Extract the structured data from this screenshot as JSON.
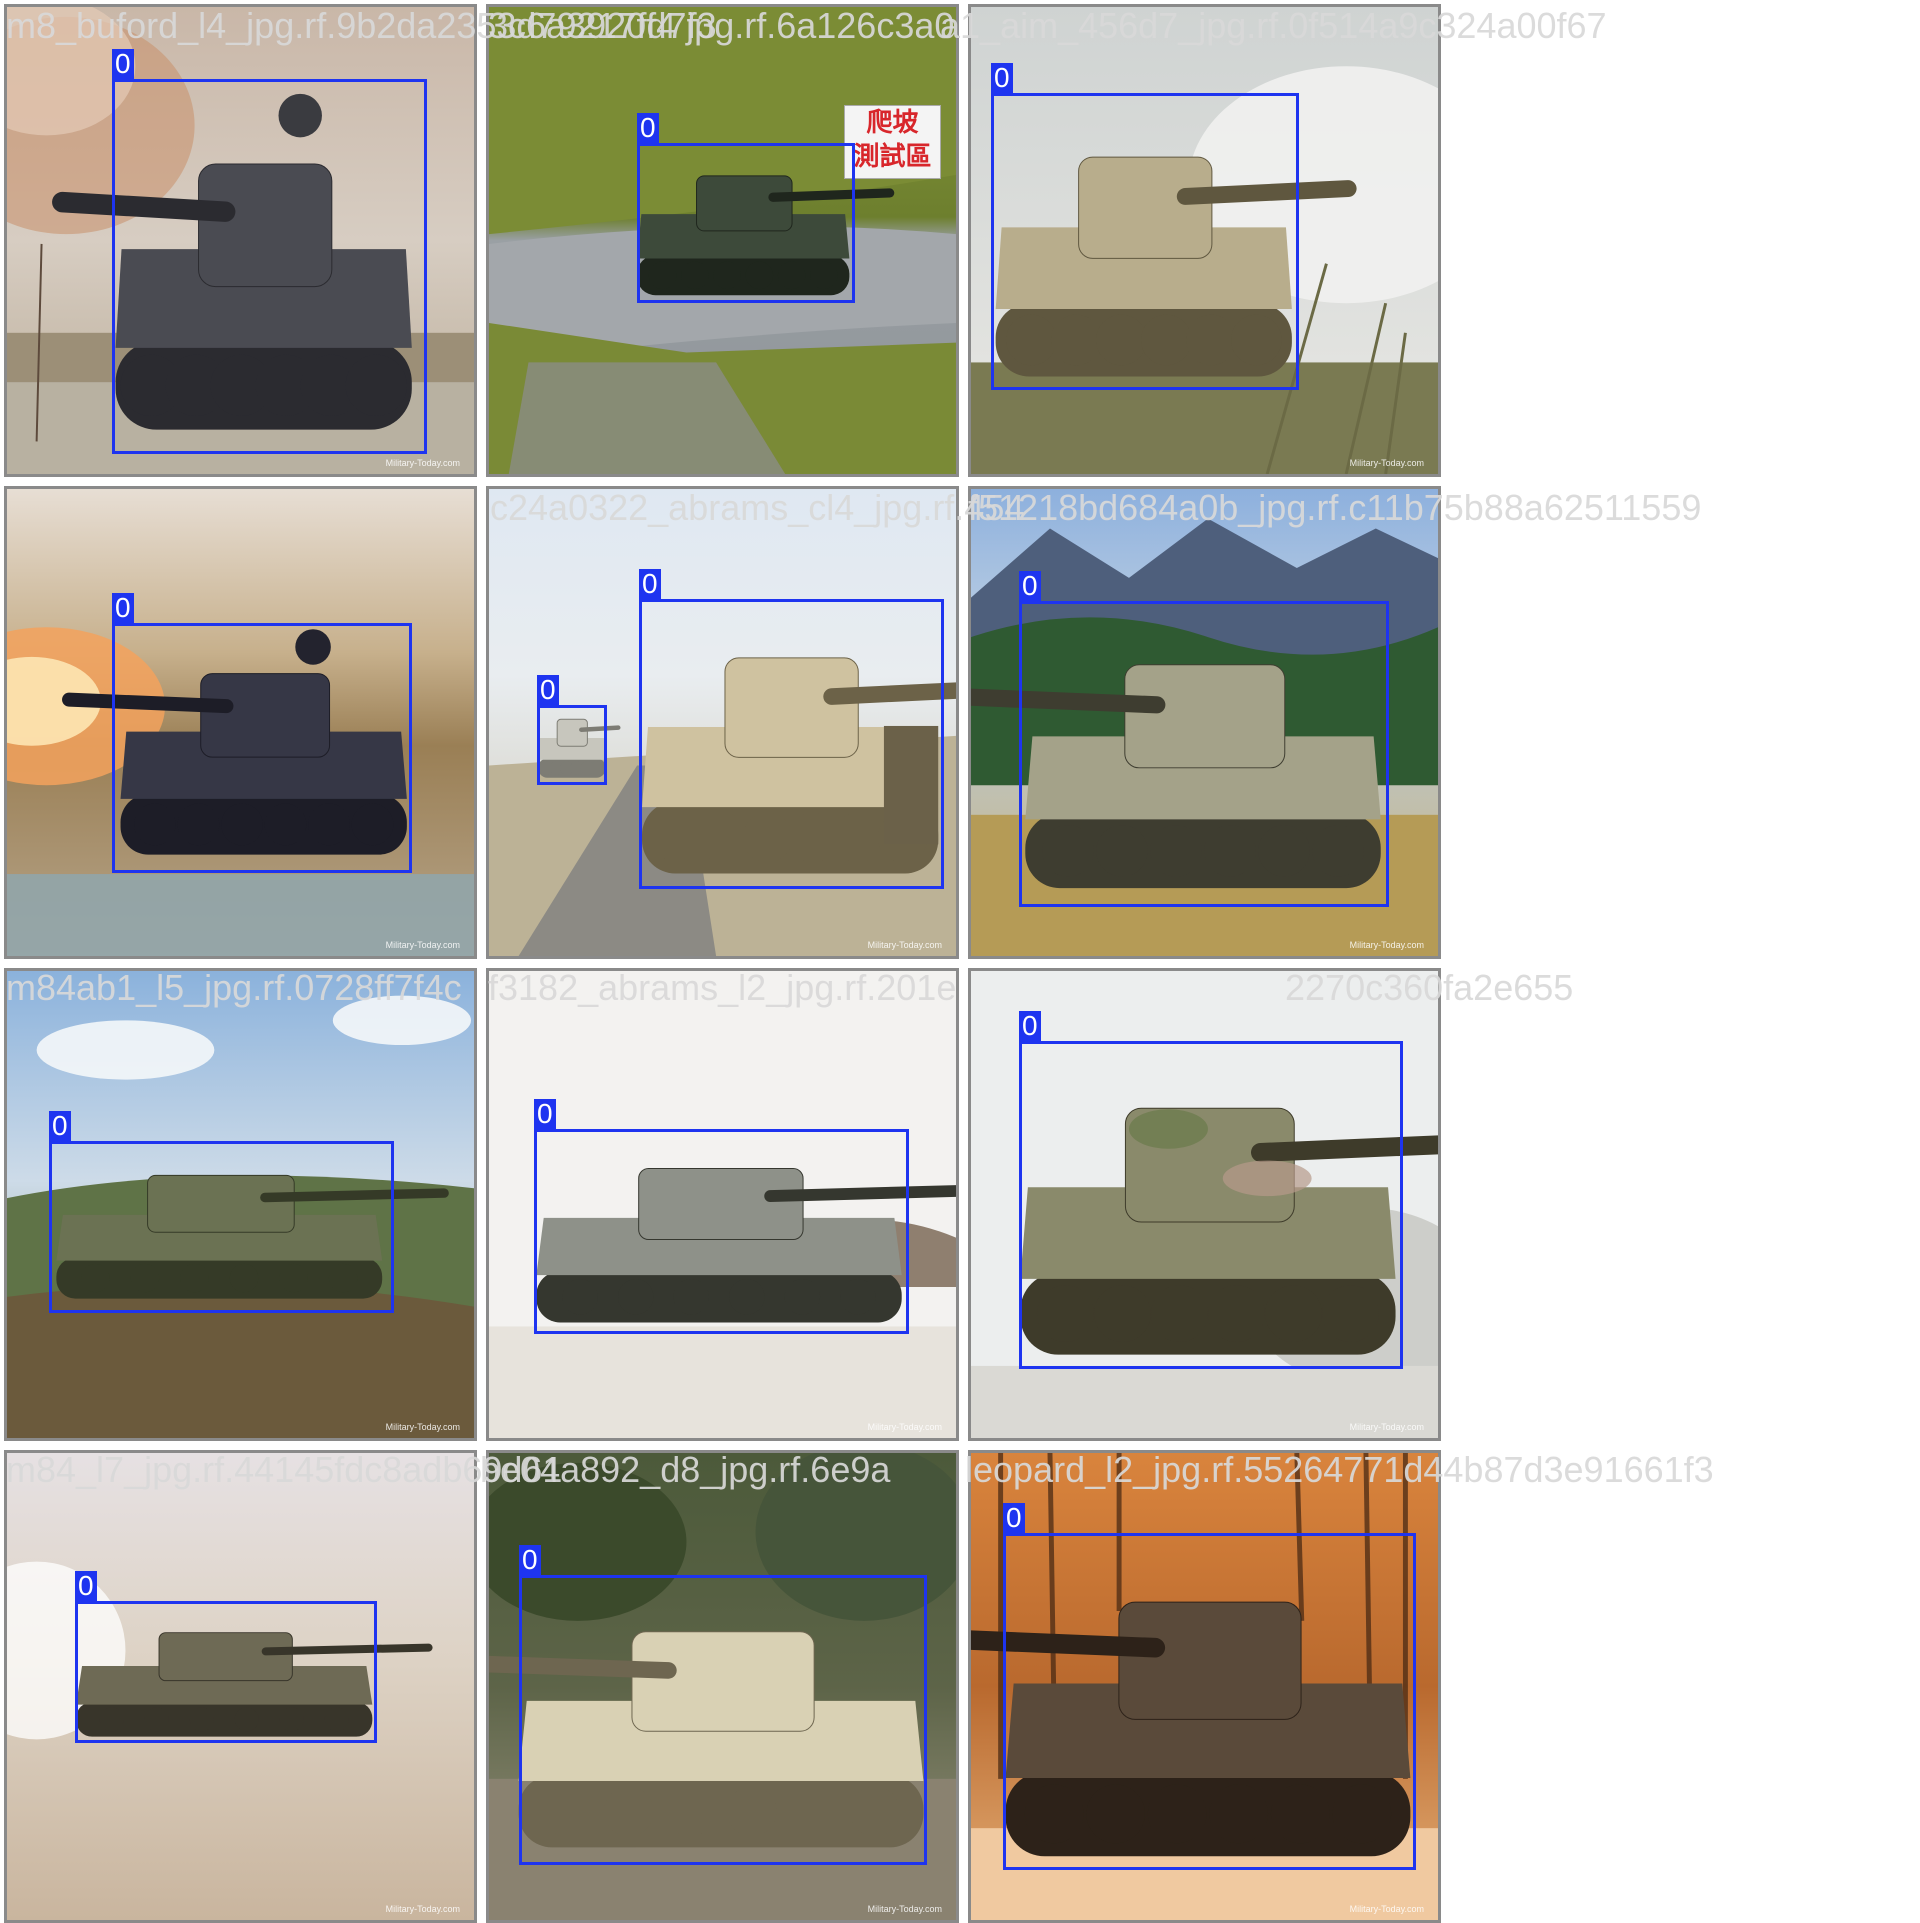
{
  "mosaic": {
    "tiles": [
      {
        "filename": "m8_buford_l4_jpg.rf.9b2da2353d79217fd7f3",
        "scene": "smoke",
        "watermark": "Military-Today.com",
        "boxes": [
          {
            "label": "0"
          }
        ]
      },
      {
        "filename": "3c6a3920f4 jpg.rf.6a126c3a0",
        "scene": "road",
        "watermark": "",
        "sign": "爬坡\n測試區",
        "boxes": [
          {
            "label": "0"
          }
        ]
      },
      {
        "filename": "a1_aim_456d7_jpg.rf.0f514a9c324a00f67",
        "scene": "dust",
        "watermark": "Military-Today.com",
        "boxes": [
          {
            "label": "0"
          }
        ]
      },
      {
        "filename": "",
        "scene": "fire",
        "watermark": "Military-Today.com",
        "boxes": [
          {
            "label": "0"
          }
        ]
      },
      {
        "filename": "c24a0322_abrams_cl4_jpg.rf.454",
        "scene": "convoy",
        "watermark": "Military-Today.com",
        "boxes": [
          {
            "label": "0"
          },
          {
            "label": "0"
          }
        ]
      },
      {
        "filename": "f51218bd684a0b_jpg.rf.c11b75b88a62511559",
        "scene": "mountain",
        "watermark": "Military-Today.com",
        "boxes": [
          {
            "label": "0"
          }
        ]
      },
      {
        "filename": "m84ab1_l5_jpg.rf.0728ff7f4c",
        "scene": "hill",
        "watermark": "Military-Today.com",
        "boxes": [
          {
            "label": "0"
          }
        ]
      },
      {
        "filename": "f3182_abrams_l2_jpg.rf.201e",
        "scene": "white",
        "watermark": "Military-Today.com",
        "boxes": [
          {
            "label": "0"
          }
        ]
      },
      {
        "filename": "2270c360fa2e655",
        "scene": "leopard",
        "watermark": "Military-Today.com",
        "boxes": [
          {
            "label": "0"
          }
        ]
      },
      {
        "filename": "m84_l7_jpg.rf.44145fdc8adb69d61",
        "scene": "desert",
        "watermark": "Military-Today.com",
        "boxes": [
          {
            "label": "0"
          }
        ]
      },
      {
        "filename": "be04a892_d8_jpg.rf.6e9a",
        "scene": "forest",
        "watermark": "Military-Today.com",
        "boxes": [
          {
            "label": "0"
          }
        ]
      },
      {
        "filename": "leopard_l2_jpg.rf.55264771d44b87d3e91661f3",
        "scene": "sepia",
        "watermark": "Military-Today.com",
        "boxes": [
          {
            "label": "0"
          }
        ]
      }
    ],
    "colors": {
      "box": "#1e34f0",
      "label_text": "#ffffff",
      "filename_text": "#d9d9d9",
      "tile_border": "#8a8a8a"
    }
  }
}
